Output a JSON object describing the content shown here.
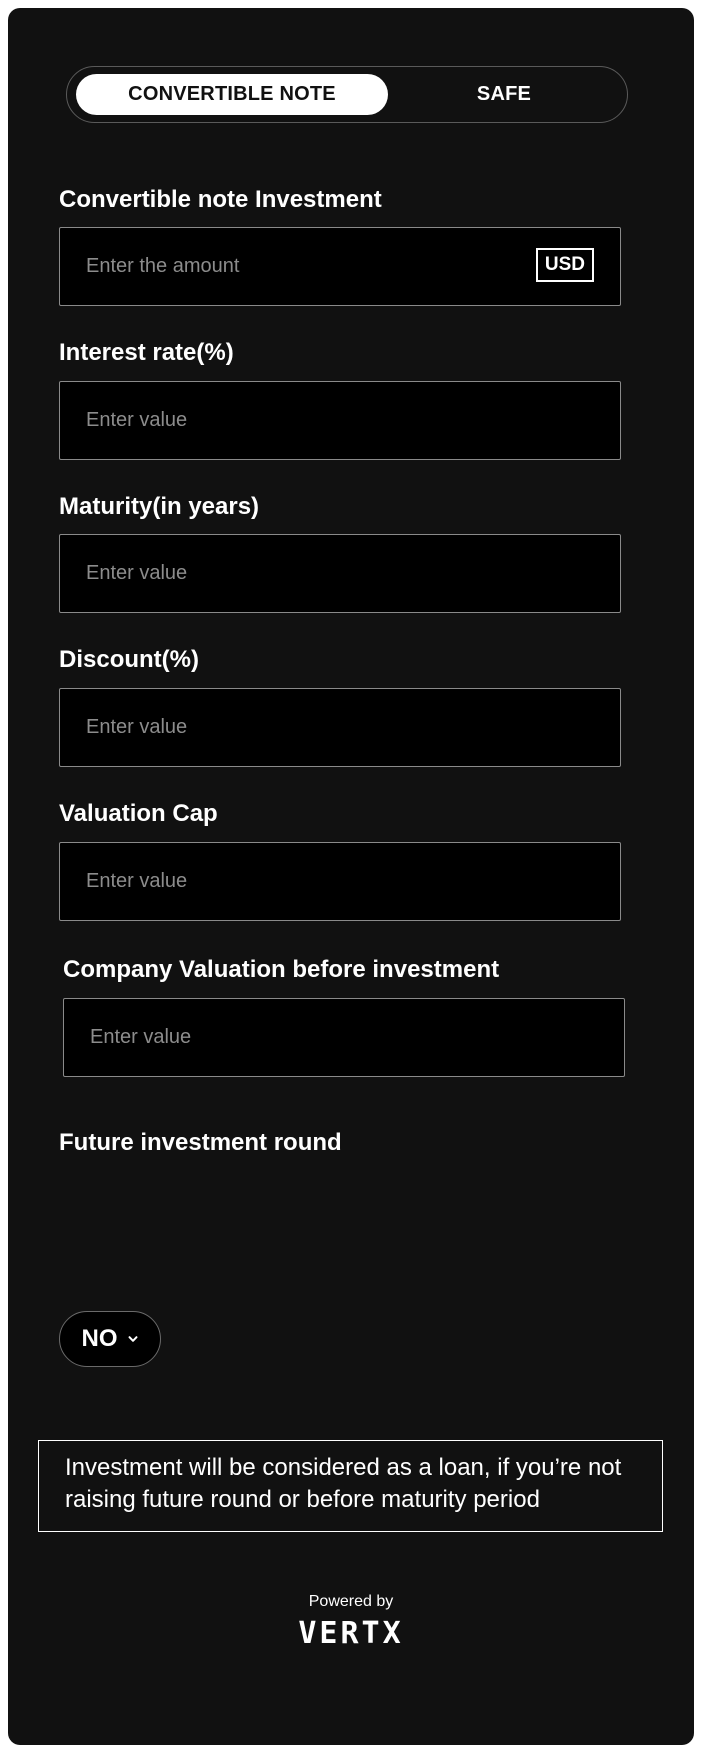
{
  "toggle": {
    "options": [
      "CONVERTIBLE NOTE",
      "SAFE"
    ],
    "selected": "CONVERTIBLE NOTE"
  },
  "fields": {
    "investment": {
      "label": "Convertible note Investment",
      "placeholder": "Enter the amount",
      "currency": "USD"
    },
    "interest_rate": {
      "label": "Interest rate(%)",
      "placeholder": "Enter value"
    },
    "maturity": {
      "label": "Maturity(in years)",
      "placeholder": "Enter value"
    },
    "discount": {
      "label": "Discount(%)",
      "placeholder": "Enter value"
    },
    "valuation_cap": {
      "label": "Valuation Cap",
      "placeholder": "Enter value"
    },
    "company_valuation": {
      "label": "Company Valuation before investment",
      "placeholder": "Enter value"
    }
  },
  "future_round": {
    "label": "Future investment round",
    "value": "NO",
    "icon": "chevron-down-icon"
  },
  "notice": {
    "text": "Investment will be considered as a loan, if you’re not raising future round or before maturity period"
  },
  "footer": {
    "powered_by": "Powered by",
    "brand": "VERTX"
  },
  "colors": {
    "card_bg": "#111111",
    "field_bg": "#000000",
    "accent": "#ffffff",
    "placeholder": "#8c8c8c"
  }
}
